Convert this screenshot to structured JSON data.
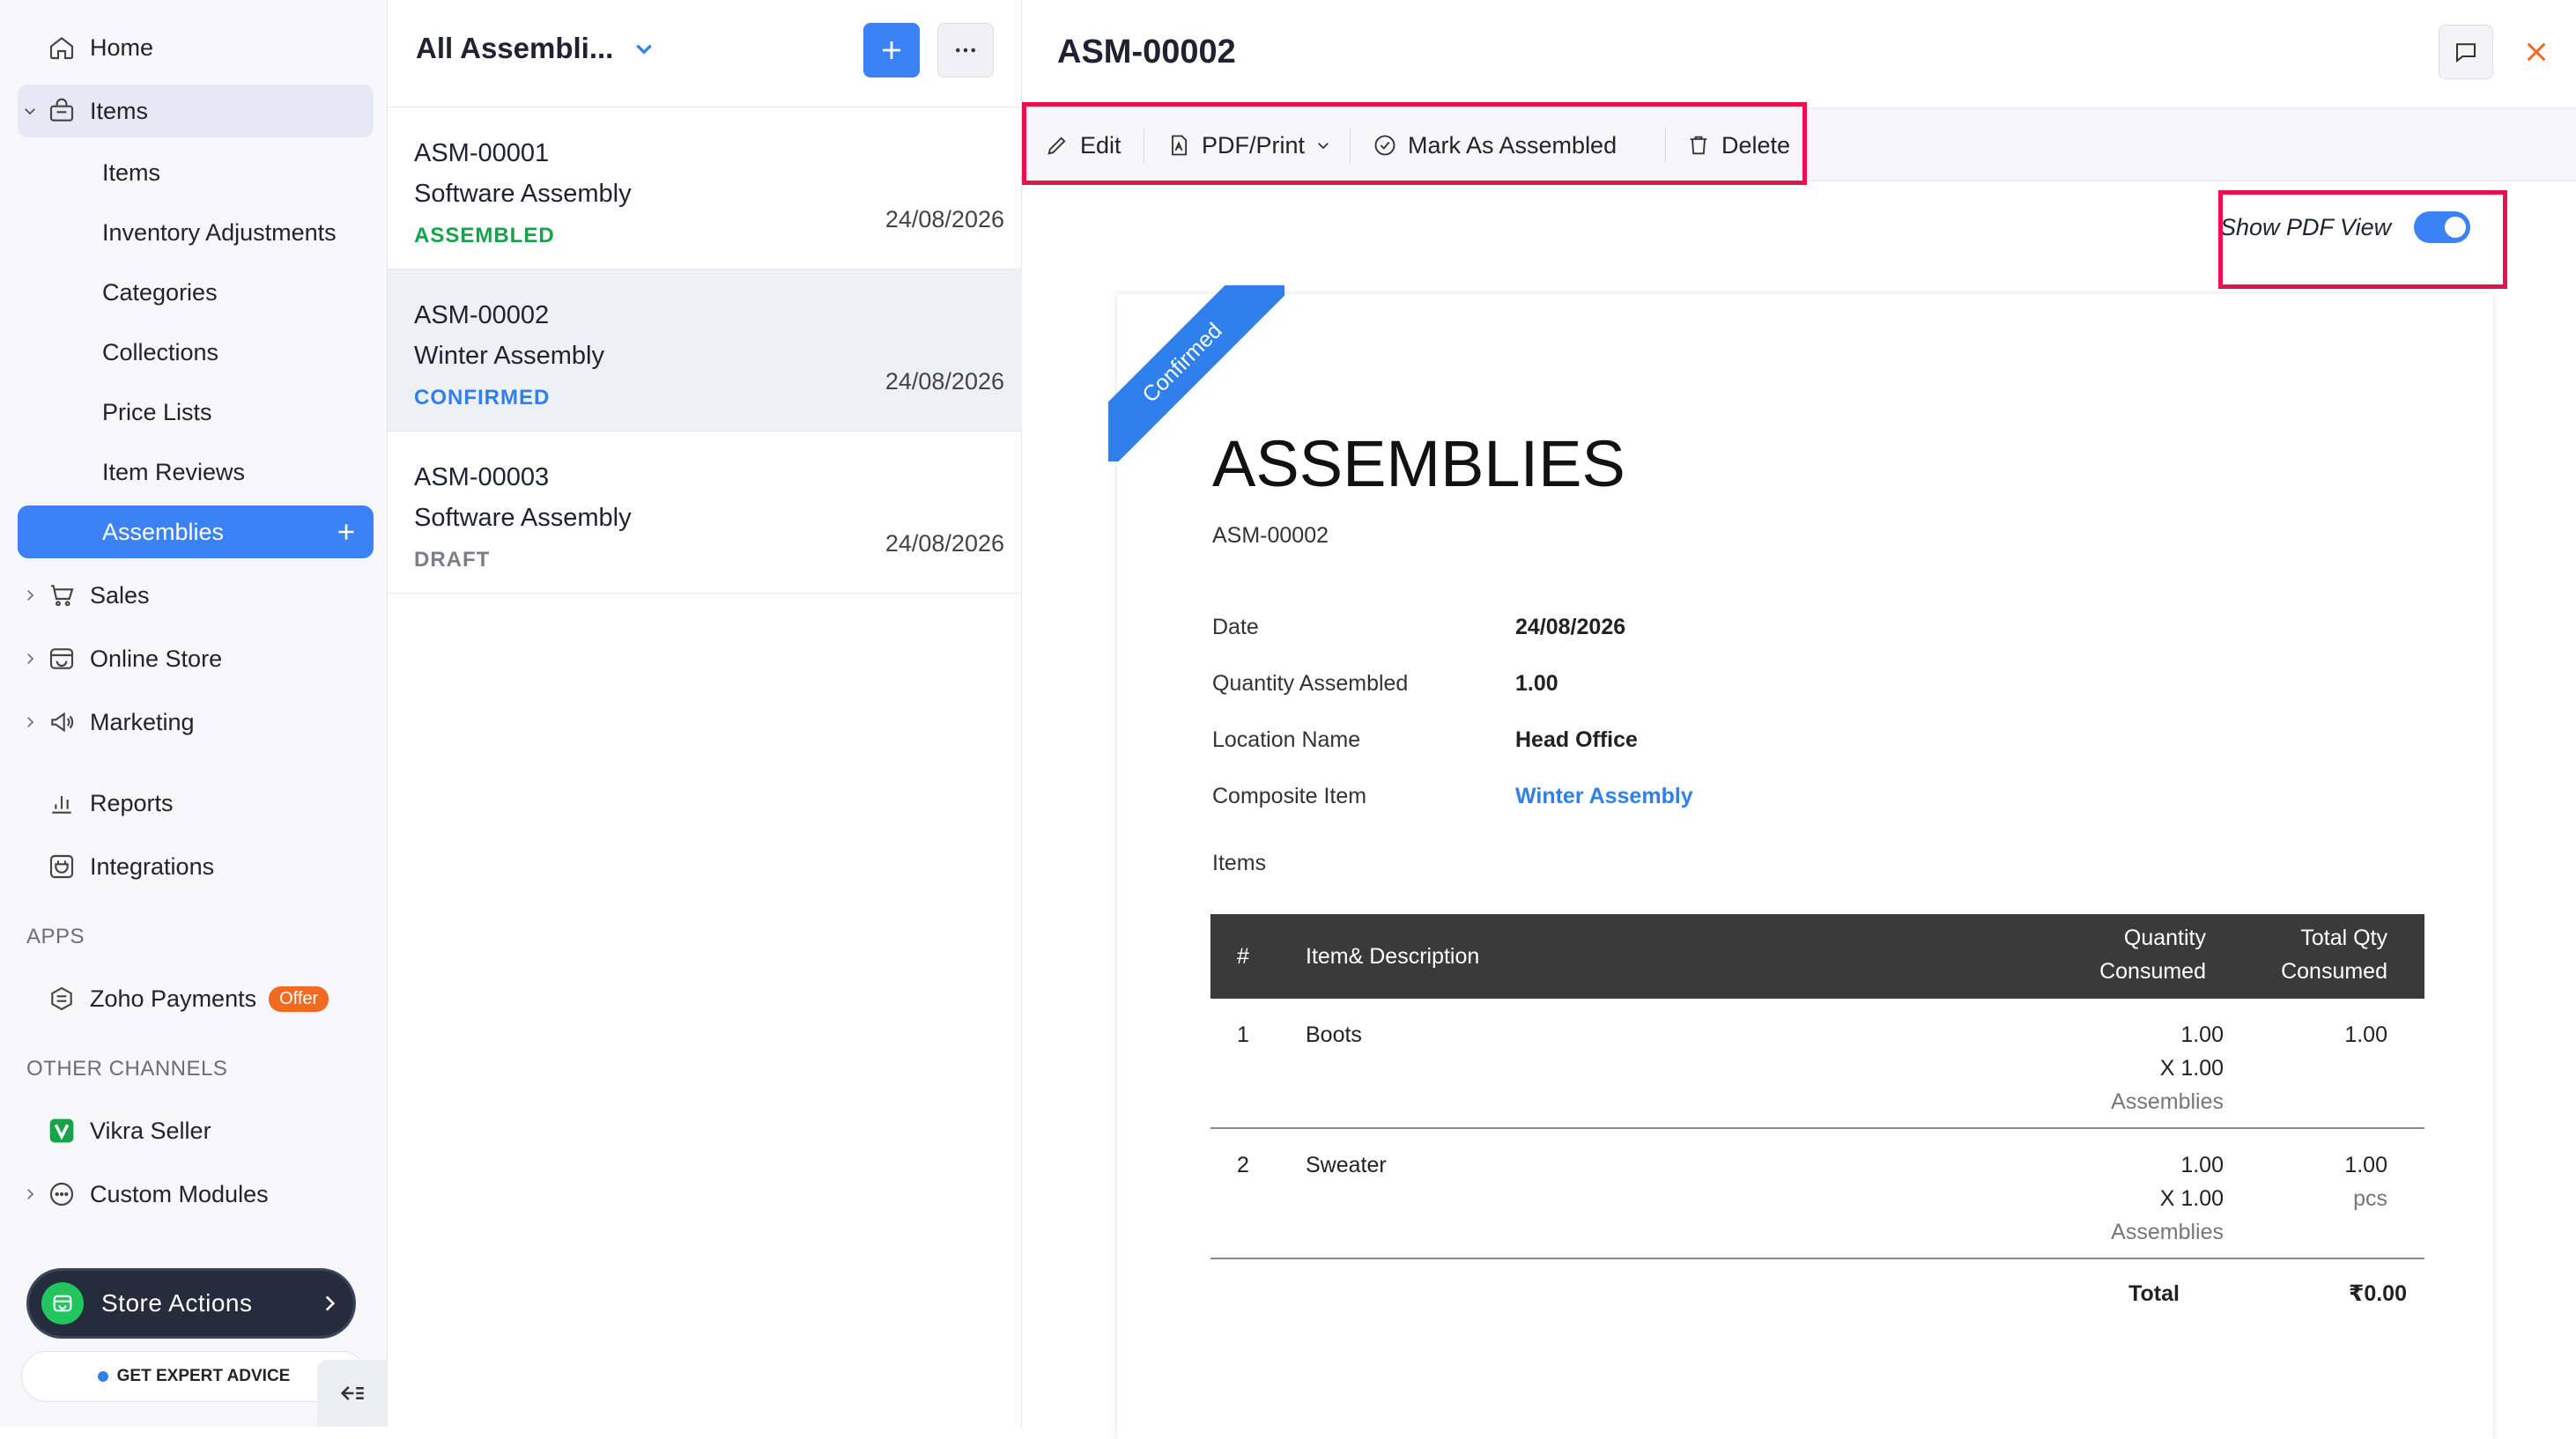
{
  "sidebar": {
    "home": "Home",
    "items_group": "Items",
    "sub_items": [
      "Items",
      "Inventory Adjustments",
      "Categories",
      "Collections",
      "Price Lists",
      "Item Reviews"
    ],
    "assemblies": "Assemblies",
    "sales": "Sales",
    "online_store": "Online Store",
    "marketing": "Marketing",
    "reports": "Reports",
    "integrations": "Integrations",
    "apps_heading": "APPS",
    "zoho_payments": "Zoho Payments",
    "offer_badge": "Offer",
    "other_channels_heading": "OTHER CHANNELS",
    "vikra_seller": "Vikra Seller",
    "custom_modules": "Custom Modules",
    "store_actions": "Store Actions",
    "expert_advice": "GET EXPERT ADVICE"
  },
  "list": {
    "view_title": "All Assembli...",
    "records": [
      {
        "id": "ASM-00001",
        "name": "Software Assembly",
        "status": "ASSEMBLED",
        "date": "24/08/2026"
      },
      {
        "id": "ASM-00002",
        "name": "Winter Assembly",
        "status": "CONFIRMED",
        "date": "24/08/2026"
      },
      {
        "id": "ASM-00003",
        "name": "Software Assembly",
        "status": "DRAFT",
        "date": "24/08/2026"
      }
    ]
  },
  "detail": {
    "title": "ASM-00002",
    "toolbar": {
      "edit": "Edit",
      "pdf_print": "PDF/Print",
      "mark_assembled": "Mark As Assembled",
      "delete": "Delete"
    },
    "show_pdf_view": "Show PDF View",
    "show_pdf_view_on": true,
    "document": {
      "ribbon": "Confirmed",
      "heading": "ASSEMBLIES",
      "number": "ASM-00002",
      "fields": {
        "date_label": "Date",
        "date_value": "24/08/2026",
        "qty_label": "Quantity Assembled",
        "qty_value": "1.00",
        "location_label": "Location Name",
        "location_value": "Head Office",
        "composite_label": "Composite Item",
        "composite_value": "Winter Assembly"
      },
      "items_label": "Items",
      "table": {
        "col_num": "#",
        "col_item": "Item& Description",
        "col_qty_1": "Quantity",
        "col_qty_2": "Consumed",
        "col_total_1": "Total Qty",
        "col_total_2": "Consumed",
        "rows": [
          {
            "num": "1",
            "item": "Boots",
            "qty": "1.00",
            "times": "X 1.00",
            "unit": "Assemblies",
            "total": "1.00",
            "total_unit": ""
          },
          {
            "num": "2",
            "item": "Sweater",
            "qty": "1.00",
            "times": "X 1.00",
            "unit": "Assemblies",
            "total": "1.00",
            "total_unit": "pcs"
          }
        ],
        "total_label": "Total",
        "total_value": "₹0.00"
      }
    }
  },
  "colors": {
    "accent": "#3b82f6",
    "assembled": "#16a34a",
    "confirmed": "#2f80ed",
    "draft": "#7b7d88",
    "highlight": "#e8134e",
    "store_actions_bg": "#252c3b",
    "offer": "#f06a24"
  }
}
